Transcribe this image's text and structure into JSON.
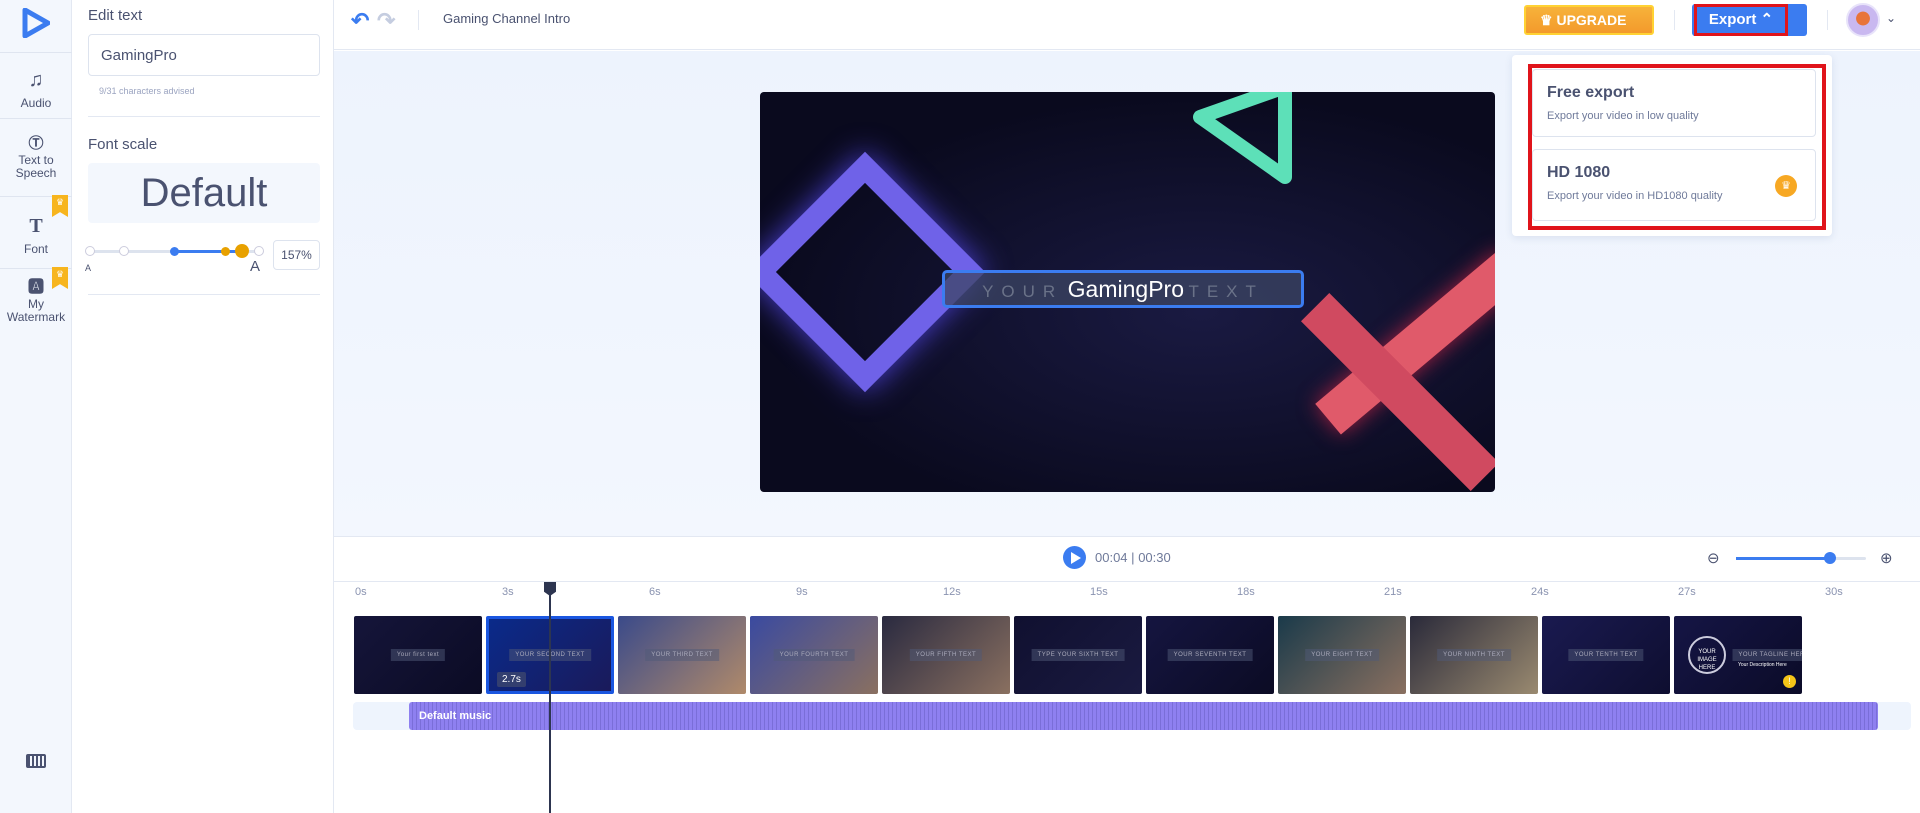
{
  "rail": {
    "items": [
      {
        "label": "Audio",
        "icon": "music-note-icon"
      },
      {
        "label": "Text to Speech",
        "icon": "text-to-speech-icon"
      },
      {
        "label": "Font",
        "icon": "font-icon",
        "premium": true
      },
      {
        "label": "My Watermark",
        "icon": "watermark-icon",
        "premium": true
      }
    ]
  },
  "panel": {
    "edit_text_title": "Edit text",
    "text_value": "GamingPro",
    "char_hint": "9/31  characters advised",
    "font_scale_title": "Font scale",
    "font_preview": "Default",
    "slider_min_label": "A",
    "slider_max_label": "A",
    "scale_value": "157%",
    "scale_level_percent": 157
  },
  "topbar": {
    "project_title": "Gaming Channel Intro",
    "upgrade_label": "UPGRADE",
    "export_label": "Export"
  },
  "export_menu": {
    "options": [
      {
        "title": "Free export",
        "desc": "Export your video in low quality"
      },
      {
        "title": "HD 1080",
        "desc": "Export your video in HD1080 quality",
        "premium": true
      }
    ]
  },
  "preview": {
    "text_before": "YOUR",
    "text_main": "GamingPro",
    "text_after": "TEXT"
  },
  "player": {
    "current": "00:04",
    "total": "00:30",
    "separator": "|",
    "zoom_level_fraction": 0.72
  },
  "ruler": [
    "0s",
    "3s",
    "6s",
    "9s",
    "12s",
    "15s",
    "18s",
    "21s",
    "24s",
    "27s",
    "30s"
  ],
  "clips": [
    {
      "caption": "Your first text"
    },
    {
      "caption": "YOUR SECOND TEXT",
      "duration": "2.7s",
      "selected": true
    },
    {
      "caption": "YOUR THIRD TEXT"
    },
    {
      "caption": "YOUR FOURTH TEXT"
    },
    {
      "caption": "YOUR FIFTH TEXT"
    },
    {
      "caption": "TYPE YOUR SIXTH TEXT"
    },
    {
      "caption": "YOUR SEVENTH TEXT"
    },
    {
      "caption": "YOUR EIGHT TEXT"
    },
    {
      "caption": "YOUR NINTH TEXT"
    },
    {
      "caption": "YOUR TENTH TEXT"
    },
    {
      "caption": "YOUR TAGLINE HERE",
      "extra": "YOUR IMAGE HERE",
      "desc": "Your Description Here"
    }
  ],
  "music": {
    "label": "Default music"
  },
  "colors": {
    "accent": "#3b7cf0",
    "premium": "#f7a823",
    "music": "#8e80f0",
    "highlight": "#e0141b"
  }
}
